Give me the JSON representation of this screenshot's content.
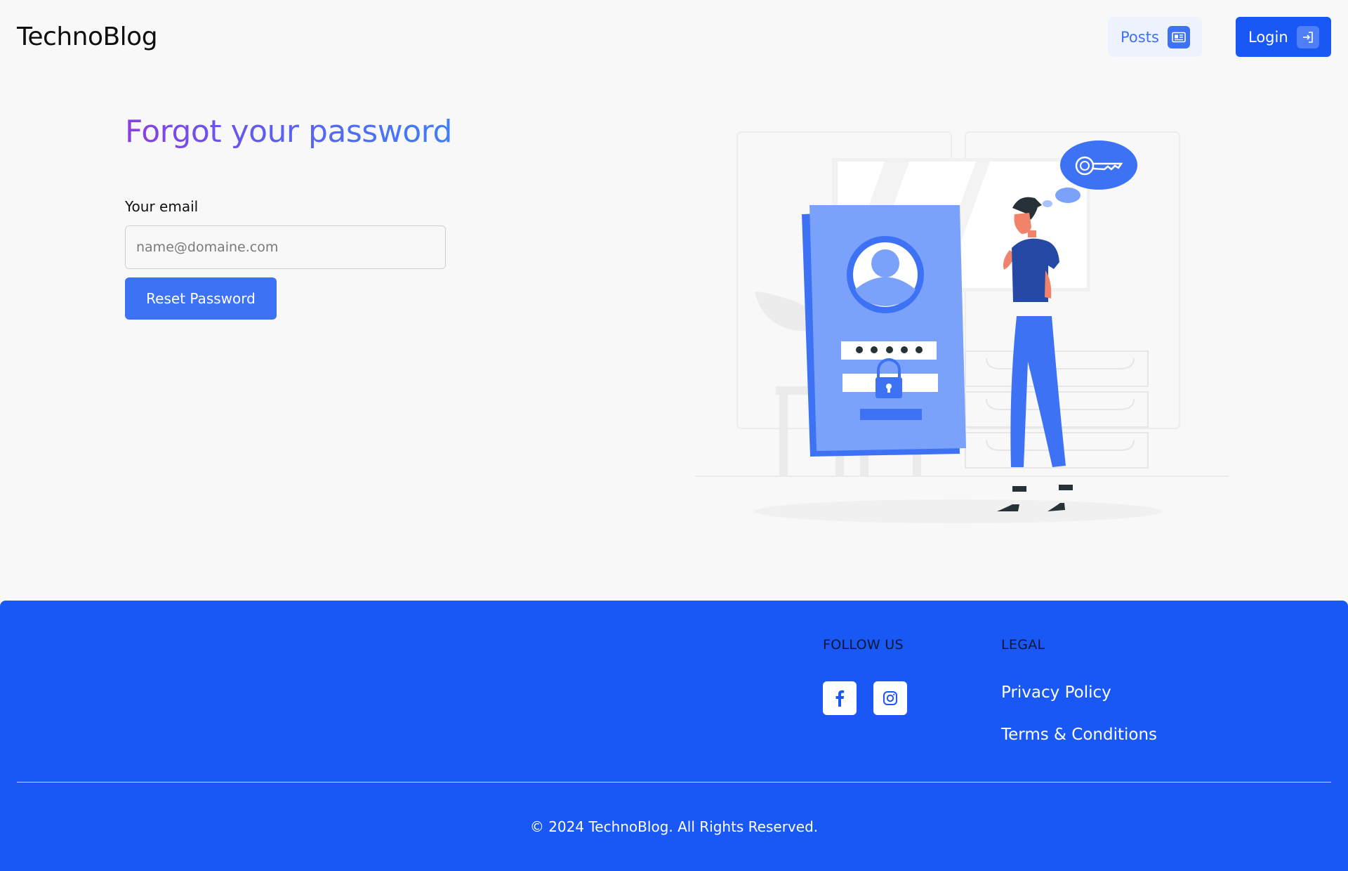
{
  "header": {
    "brand": "TechnoBlog",
    "nav": {
      "posts_label": "Posts",
      "posts_icon": "newspaper-icon",
      "login_label": "Login",
      "login_icon": "login-icon"
    }
  },
  "form": {
    "title": "Forgot your password",
    "email_label": "Your email",
    "email_placeholder": "name@domaine.com",
    "email_value": "",
    "submit_label": "Reset Password"
  },
  "footer": {
    "follow_heading": "FOLLOW US",
    "social": [
      {
        "name": "facebook-icon"
      },
      {
        "name": "instagram-icon"
      }
    ],
    "legal_heading": "LEGAL",
    "legal_links": [
      "Privacy Policy",
      "Terms & Conditions"
    ],
    "copyright": "© 2024 TechnoBlog. All Rights Reserved."
  },
  "colors": {
    "primary": "#1a58f5",
    "button": "#3d72f5",
    "background": "#f8f8f8",
    "title_gradient_start": "#8a3fe0",
    "title_gradient_end": "#3f7ff5"
  }
}
